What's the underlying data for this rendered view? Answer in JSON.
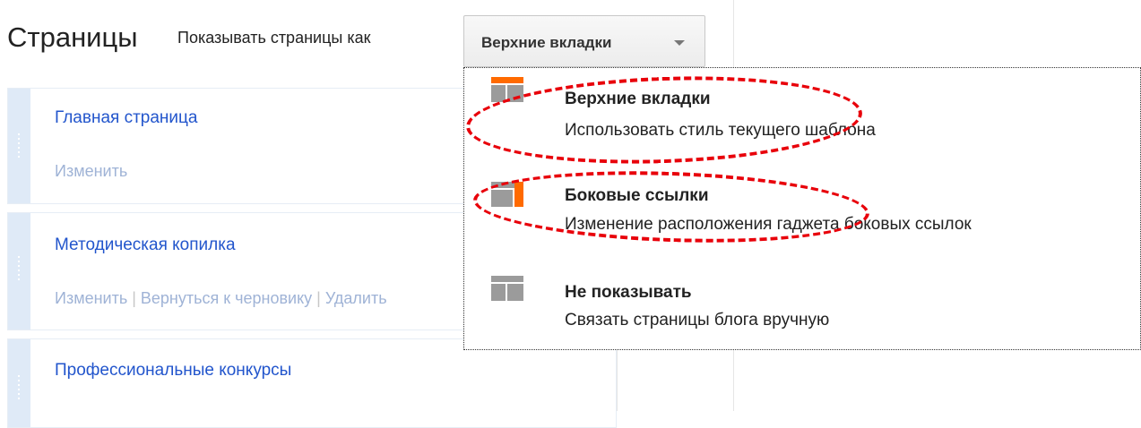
{
  "header": {
    "title": "Страницы",
    "show_label": "Показывать страницы как",
    "dropdown_value": "Верхние вкладки"
  },
  "pages": [
    {
      "title": "Главная страница",
      "actions": [
        "Изменить"
      ]
    },
    {
      "title": "Методическая копилка",
      "actions": [
        "Изменить",
        "Вернуться к черновику",
        "Удалить"
      ]
    },
    {
      "title": "Профессиональные конкурсы",
      "actions": []
    }
  ],
  "menu": {
    "items": [
      {
        "title": "Верхние вкладки",
        "description": "Использовать стиль текущего шаблона",
        "icon": "top-tabs-icon",
        "highlighted": true
      },
      {
        "title": "Боковые ссылки",
        "description": "Изменение расположения гаджета боковых ссылок",
        "icon": "side-links-icon",
        "highlighted": true
      },
      {
        "title": "Не показывать",
        "description": "Связать страницы блога вручную",
        "icon": "no-display-icon",
        "highlighted": false
      }
    ]
  },
  "colors": {
    "link": "#2255cc",
    "action_link": "#9fb3d6",
    "accent_orange": "#ff6a00",
    "icon_gray": "#9b9b9b",
    "annotation_red": "#e8000a",
    "handle_blue": "#dfeaf7"
  }
}
